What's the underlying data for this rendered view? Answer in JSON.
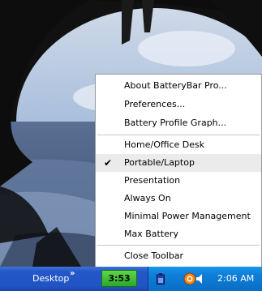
{
  "context_menu": {
    "items": [
      {
        "label": "About BatteryBar Pro..."
      },
      {
        "label": "Preferences..."
      },
      {
        "label": "Battery Profile Graph..."
      },
      {
        "label": "Home/Office Desk"
      },
      {
        "label": "Portable/Laptop",
        "checked": true
      },
      {
        "label": "Presentation"
      },
      {
        "label": "Always On"
      },
      {
        "label": "Minimal Power Management"
      },
      {
        "label": "Max Battery"
      },
      {
        "label": "Close Toolbar"
      }
    ],
    "check_glyph": "✔"
  },
  "taskbar": {
    "desktop_label": "Desktop",
    "chevron": "»",
    "battery_time": "3:53",
    "battery_color": "#3cc23c",
    "clock": "2:06 AM",
    "tray_icons": [
      "battery-icon",
      "orange-circle-icon",
      "volume-icon"
    ]
  }
}
